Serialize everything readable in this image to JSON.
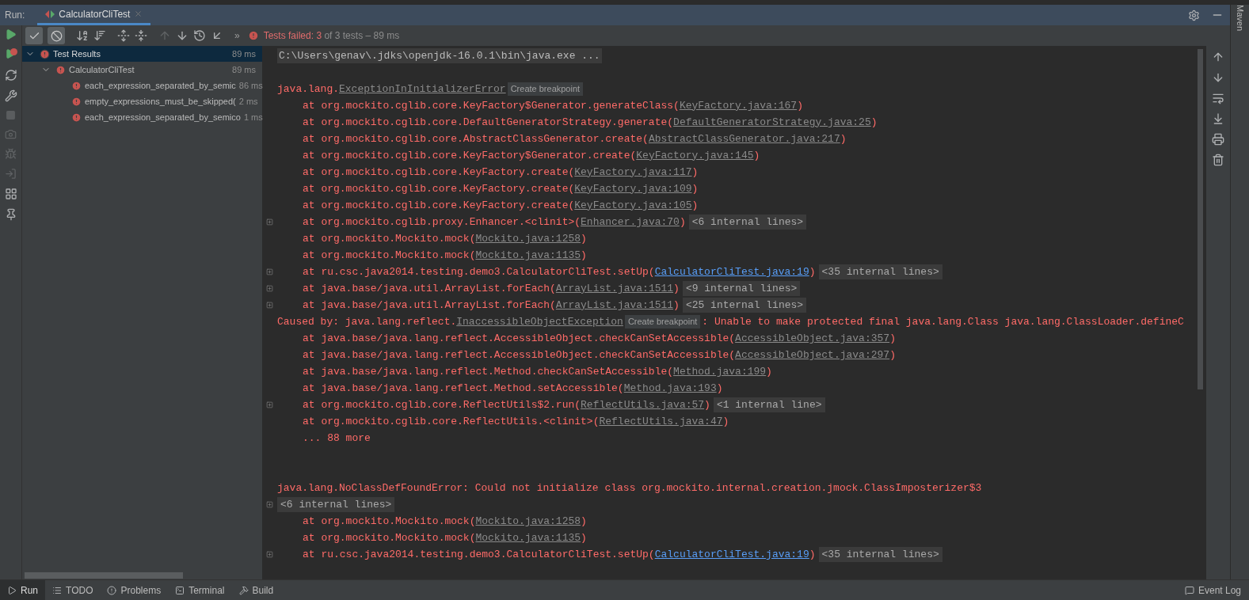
{
  "run_header": {
    "label": "Run:",
    "tab": {
      "title": "CalculatorCliTest",
      "selected": true
    }
  },
  "toolbar": {
    "toggles": [
      {
        "selected": true
      },
      {
        "selected": true
      }
    ],
    "navigation": [
      {
        "disabled": true
      },
      {
        "disabled": false
      }
    ],
    "overflow": "»"
  },
  "status": {
    "label": "Tests failed:",
    "failed": "3",
    "rest": "of 3 tests – 89 ms"
  },
  "tree": [
    {
      "name": "Test Results",
      "time": "89 ms",
      "failed": true,
      "selected": true,
      "expanded": true,
      "children": [
        {
          "name": "CalculatorCliTest",
          "time": "89 ms",
          "failed": true,
          "selected": false,
          "expanded": true,
          "children": [
            {
              "name": "each_expression_separated_by_semic",
              "time": "86 ms",
              "failed": true,
              "selected": false
            },
            {
              "name": "empty_expressions_must_be_skipped(",
              "time": "2 ms",
              "failed": true,
              "selected": false
            },
            {
              "name": "each_expression_separated_by_semico",
              "time": "1 ms",
              "failed": true,
              "selected": false
            }
          ]
        }
      ]
    }
  ],
  "console": [
    {
      "kind": "cmd",
      "text": "C:\\Users\\genav\\.jdks\\openjdk-16.0.1\\bin\\java.exe ..."
    },
    {
      "kind": "blank"
    },
    {
      "kind": "exception",
      "text": "java.lang.",
      "link": "ExceptionInInitializerError",
      "badge": "Create breakpoint"
    },
    {
      "kind": "frame",
      "text": "at org.mockito.cglib.core.KeyFactory$Generator.generateClass(",
      "link": "KeyFactory.java:167",
      "tail": ")",
      "own_code": false
    },
    {
      "kind": "frame",
      "text": "at org.mockito.cglib.core.DefaultGeneratorStrategy.generate(",
      "link": "DefaultGeneratorStrategy.java:25",
      "tail": ")",
      "own_code": false
    },
    {
      "kind": "frame",
      "text": "at org.mockito.cglib.core.AbstractClassGenerator.create(",
      "link": "AbstractClassGenerator.java:217",
      "tail": ")",
      "own_code": false
    },
    {
      "kind": "frame",
      "text": "at org.mockito.cglib.core.KeyFactory$Generator.create(",
      "link": "KeyFactory.java:145",
      "tail": ")",
      "own_code": false
    },
    {
      "kind": "frame",
      "text": "at org.mockito.cglib.core.KeyFactory.create(",
      "link": "KeyFactory.java:117",
      "tail": ")",
      "own_code": false
    },
    {
      "kind": "frame",
      "text": "at org.mockito.cglib.core.KeyFactory.create(",
      "link": "KeyFactory.java:109",
      "tail": ")",
      "own_code": false
    },
    {
      "kind": "frame",
      "text": "at org.mockito.cglib.core.KeyFactory.create(",
      "link": "KeyFactory.java:105",
      "tail": ")",
      "own_code": false
    },
    {
      "kind": "frame",
      "text": "at org.mockito.cglib.proxy.Enhancer.<clinit>(",
      "link": "Enhancer.java:70",
      "tail": ")",
      "own_code": false,
      "folded": "<6 internal lines>"
    },
    {
      "kind": "frame",
      "text": "at org.mockito.Mockito.mock(",
      "link": "Mockito.java:1258",
      "tail": ")",
      "own_code": false
    },
    {
      "kind": "frame",
      "text": "at org.mockito.Mockito.mock(",
      "link": "Mockito.java:1135",
      "tail": ")",
      "own_code": false
    },
    {
      "kind": "frame",
      "text": "at ru.csc.java2014.testing.demo3.CalculatorCliTest.setUp(",
      "link": "CalculatorCliTest.java:19",
      "tail": ")",
      "own_code": true,
      "folded": "<35 internal lines>"
    },
    {
      "kind": "frame",
      "text": "at java.base/java.util.ArrayList.forEach(",
      "link": "ArrayList.java:1511",
      "tail": ")",
      "own_code": false,
      "folded": "<9 internal lines>"
    },
    {
      "kind": "frame",
      "text": "at java.base/java.util.ArrayList.forEach(",
      "link": "ArrayList.java:1511",
      "tail": ")",
      "own_code": false,
      "folded": "<25 internal lines>"
    },
    {
      "kind": "caused",
      "text": "Caused by: java.lang.reflect.",
      "link": "InaccessibleObjectException",
      "badge": "Create breakpoint",
      "tail": ": Unable to make protected final java.lang.Class java.lang.ClassLoader.defineC"
    },
    {
      "kind": "frame",
      "text": "at java.base/java.lang.reflect.AccessibleObject.checkCanSetAccessible(",
      "link": "AccessibleObject.java:357",
      "tail": ")",
      "own_code": false
    },
    {
      "kind": "frame",
      "text": "at java.base/java.lang.reflect.AccessibleObject.checkCanSetAccessible(",
      "link": "AccessibleObject.java:297",
      "tail": ")",
      "own_code": false
    },
    {
      "kind": "frame",
      "text": "at java.base/java.lang.reflect.Method.checkCanSetAccessible(",
      "link": "Method.java:199",
      "tail": ")",
      "own_code": false
    },
    {
      "kind": "frame",
      "text": "at java.base/java.lang.reflect.Method.setAccessible(",
      "link": "Method.java:193",
      "tail": ")",
      "own_code": false
    },
    {
      "kind": "frame",
      "text": "at org.mockito.cglib.core.ReflectUtils$2.run(",
      "link": "ReflectUtils.java:57",
      "tail": ")",
      "own_code": false,
      "folded": "<1 internal line>"
    },
    {
      "kind": "frame",
      "text": "at org.mockito.cglib.core.ReflectUtils.<clinit>(",
      "link": "ReflectUtils.java:47",
      "tail": ")",
      "own_code": false
    },
    {
      "kind": "more",
      "text": "... 88 more"
    },
    {
      "kind": "blank"
    },
    {
      "kind": "blank"
    },
    {
      "kind": "error",
      "text": "java.lang.NoClassDefFoundError: Could not initialize class org.mockito.internal.creation.jmock.ClassImposterizer$3"
    },
    {
      "kind": "internal",
      "folded": "<6 internal lines>"
    },
    {
      "kind": "frame",
      "text": "at org.mockito.Mockito.mock(",
      "link": "Mockito.java:1258",
      "tail": ")",
      "own_code": false
    },
    {
      "kind": "frame",
      "text": "at org.mockito.Mockito.mock(",
      "link": "Mockito.java:1135",
      "tail": ")",
      "own_code": false
    },
    {
      "kind": "frame",
      "text": "at ru.csc.java2014.testing.demo3.CalculatorCliTest.setUp(",
      "link": "CalculatorCliTest.java:19",
      "tail": ")",
      "own_code": true,
      "folded": "<35 internal lines>"
    }
  ],
  "side_strip": {
    "label": "Maven"
  },
  "bottom_tabs": [
    {
      "label": "Run",
      "selected": true
    },
    {
      "label": "TODO",
      "selected": false
    },
    {
      "label": "Problems",
      "selected": false
    },
    {
      "label": "Terminal",
      "selected": false
    },
    {
      "label": "Build",
      "selected": false
    }
  ],
  "event_log": "Event Log"
}
